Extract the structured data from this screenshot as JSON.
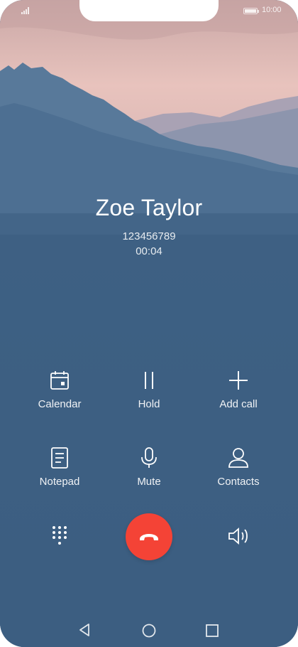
{
  "status_bar": {
    "time": "10:00",
    "signal_icon": "signal-icon",
    "battery_icon": "battery-icon"
  },
  "call": {
    "name": "Zoe Taylor",
    "number": "123456789",
    "duration": "00:04"
  },
  "actions": [
    {
      "label": "Calendar",
      "icon": "calendar-icon"
    },
    {
      "label": "Hold",
      "icon": "pause-icon"
    },
    {
      "label": "Add call",
      "icon": "plus-icon"
    },
    {
      "label": "Notepad",
      "icon": "notepad-icon"
    },
    {
      "label": "Mute",
      "icon": "microphone-icon"
    },
    {
      "label": "Contacts",
      "icon": "person-icon"
    }
  ],
  "bottom_controls": {
    "keypad_icon": "keypad-icon",
    "end_call_icon": "end-call-icon",
    "speaker_icon": "speaker-icon"
  },
  "navigation": {
    "back_icon": "back-icon",
    "home_icon": "home-icon",
    "recents_icon": "recents-icon"
  },
  "colors": {
    "background": "#3d5f82",
    "end_call": "#f44336",
    "text": "#ffffff"
  }
}
